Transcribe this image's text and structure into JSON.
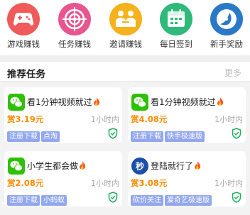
{
  "nav": {
    "items": [
      {
        "label": "游戏赚钱",
        "icon": "gamepad-icon",
        "color": "#f05a5a"
      },
      {
        "label": "任务赚钱",
        "icon": "target-icon",
        "color": "#e9558f"
      },
      {
        "label": "邀请赚钱",
        "icon": "invite-people-icon",
        "color": "#f6b21a"
      },
      {
        "label": "每日签到",
        "icon": "calendar-icon",
        "color": "#2fb97a"
      },
      {
        "label": "新手奖励",
        "icon": "compass-icon",
        "color": "#2a79c9"
      }
    ]
  },
  "section": {
    "title": "推荐任务",
    "more": "更多"
  },
  "tasks": [
    {
      "title": "看1分钟视频就过",
      "icon": "wechat-icon",
      "price": "赏3.19元",
      "time": "1小时内",
      "tags": [
        "注册下载",
        "点淘"
      ]
    },
    {
      "title": "看1分钟视频就过",
      "icon": "wechat-icon",
      "price": "赏4.08元",
      "time": "1小时内",
      "tags": [
        "注册下载",
        "快手极速版"
      ]
    },
    {
      "title": "小学生都会做",
      "icon": "wechat-icon",
      "price": "赏2.08元",
      "time": "1小时内",
      "tags": [
        "注册下载",
        "小蚂蚁"
      ]
    },
    {
      "title": "登陆就行了",
      "icon": "miao-icon",
      "iconText": "秒",
      "price": "赏3.08元",
      "time": "1小时内",
      "tags": [
        "砍价关注",
        "爱奇艺极速版"
      ]
    }
  ]
}
